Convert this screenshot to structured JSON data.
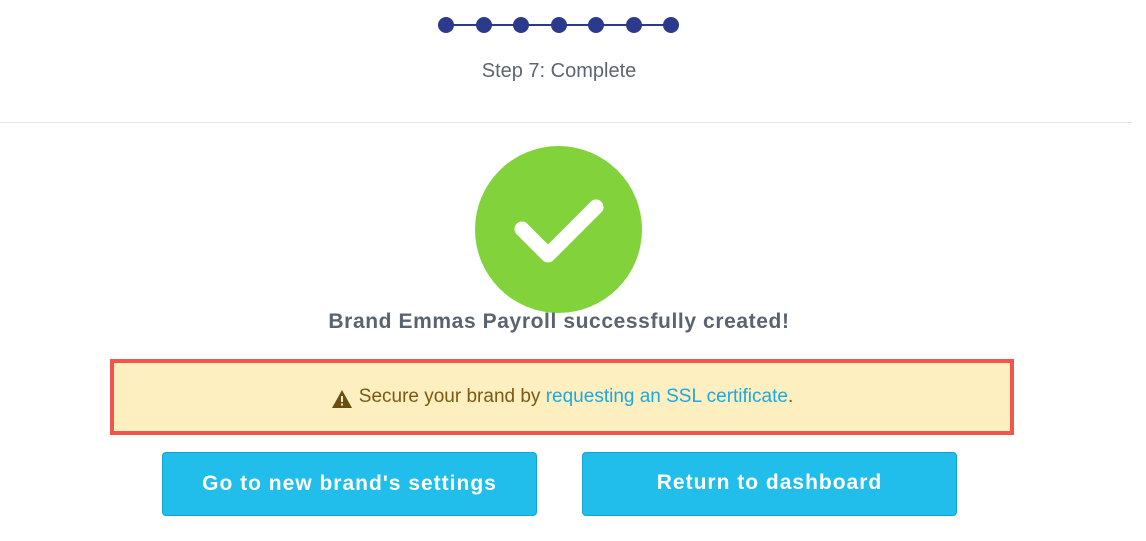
{
  "stepper": {
    "total_steps": 7,
    "current_step": 7,
    "label": "Step 7: Complete",
    "color": "#2b3a8c"
  },
  "success": {
    "icon": "checkmark-icon",
    "color": "#82d33b",
    "message": "Brand Emmas Payroll successfully created!"
  },
  "warning": {
    "icon": "warning-triangle-icon",
    "text_before": "Secure your brand by ",
    "link_text": "requesting an SSL certificate",
    "text_after": ".",
    "background": "#feefc0",
    "border_color": "#f25549"
  },
  "actions": {
    "settings_label": "Go to new brand's settings",
    "dashboard_label": "Return to dashboard",
    "button_color": "#21bdeb"
  }
}
